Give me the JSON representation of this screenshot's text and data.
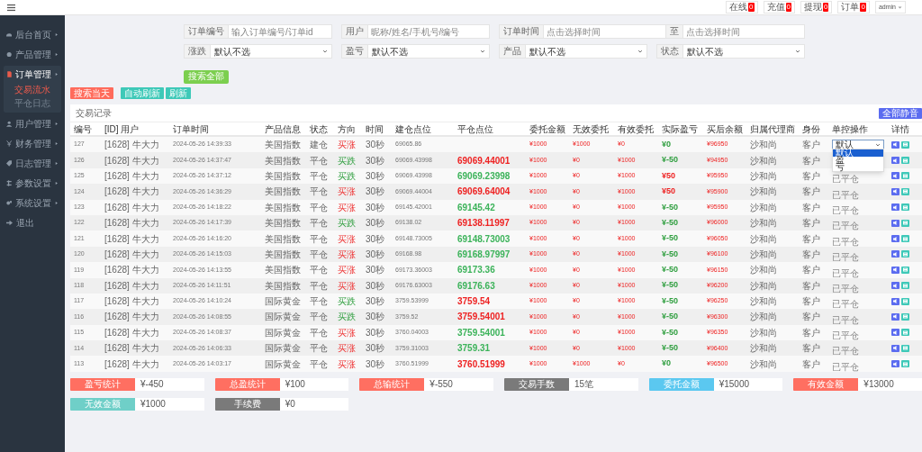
{
  "topbar": {
    "counters": [
      {
        "label": "在线",
        "count": "0"
      },
      {
        "label": "充值",
        "count": "0"
      },
      {
        "label": "提现",
        "count": "0"
      },
      {
        "label": "订单",
        "count": "0"
      }
    ],
    "user": "admin"
  },
  "sidebar": {
    "items": [
      {
        "label": "后台首页",
        "expanded": false
      },
      {
        "label": "产品管理",
        "expanded": false
      },
      {
        "label": "订单管理",
        "expanded": true,
        "children": [
          {
            "label": "交易流水",
            "selected": true
          },
          {
            "label": "平仓日志",
            "selected": false
          }
        ]
      },
      {
        "label": "用户管理",
        "expanded": false
      },
      {
        "label": "财务管理",
        "expanded": false
      },
      {
        "label": "日志管理",
        "expanded": false
      },
      {
        "label": "参数设置",
        "expanded": false
      },
      {
        "label": "系统设置",
        "expanded": false
      },
      {
        "label": "退出"
      }
    ]
  },
  "filter_rows": [
    [
      {
        "kind": "input",
        "label": "订单编号",
        "placeholder": "输入订单编号/订单id"
      },
      {
        "kind": "input",
        "label": "用户",
        "placeholder": "昵称/姓名/手机号/编号"
      },
      {
        "kind": "range",
        "label": "订单时间",
        "placeholder": "点击选择时间",
        "separator": "至",
        "placeholder_end": "点击选择时间"
      }
    ],
    [
      {
        "kind": "select",
        "label": "涨跌",
        "value": "默认不选"
      },
      {
        "kind": "select",
        "label": "盈亏",
        "value": "默认不选"
      },
      {
        "kind": "select",
        "label": "产品",
        "value": "默认不选"
      },
      {
        "kind": "select",
        "label": "状态",
        "value": "默认不选"
      }
    ]
  ],
  "search_all_button": "搜索全部",
  "action_buttons": [
    {
      "label": "搜索当天",
      "kind": "danger"
    },
    {
      "label": "自动刷新",
      "kind": "accent"
    },
    {
      "label": "刷新",
      "kind": "accent"
    }
  ],
  "table": {
    "title": "交易记录",
    "header_button": "全部静音",
    "columns": [
      "编号",
      "[ID] 用户",
      "订单时间",
      "产品信息",
      "状态",
      "方向",
      "时间",
      "建仓点位",
      "平仓点位",
      "委托金额",
      "无效委托",
      "有效委托",
      "实际盈亏",
      "买后余额",
      "归属代理商",
      "身份",
      "单控操作",
      "详情"
    ],
    "rows": [
      {
        "id": "127",
        "user": "[1628] 牛大力",
        "time": "2024-05-26 14:39:33",
        "product": "美国指数",
        "status": "建仓",
        "direction": "买涨",
        "rising": true,
        "duration": "30秒",
        "open_price": "69065.86",
        "entrust": "¥1000",
        "invalid": "¥1000",
        "valid": "¥0",
        "profit": {
          "text": "¥0",
          "color": "#2e9e3e"
        },
        "balance": "¥96950",
        "agent": "沙和尚",
        "role": "客户",
        "control": {
          "kind": "select",
          "value": "默认",
          "expanded": true,
          "options": [
            {
              "label": "默认",
              "selected": true
            },
            {
              "label": "盈",
              "selected": false
            },
            {
              "label": "亏",
              "selected": false
            }
          ]
        }
      },
      {
        "id": "126",
        "user": "[1628] 牛大力",
        "time": "2024-05-26 14:37:47",
        "product": "美国指数",
        "status": "平仓",
        "direction": "买跌",
        "rising": false,
        "duration": "30秒",
        "open_price": "69069.43998",
        "close": {
          "text": "69069.44001",
          "color": "#ee2222"
        },
        "entrust": "¥1000",
        "invalid": "¥0",
        "valid": "¥1000",
        "profit": {
          "text": "¥-50",
          "color": "#2e9e3e"
        },
        "balance": "¥94950",
        "agent": "沙和尚",
        "role": "客户"
      },
      {
        "id": "125",
        "user": "[1628] 牛大力",
        "time": "2024-05-26 14:37:12",
        "product": "美国指数",
        "status": "平仓",
        "direction": "买跌",
        "rising": false,
        "duration": "30秒",
        "open_price": "69069.43998",
        "close": {
          "text": "69069.23998",
          "color": "#3cb35a"
        },
        "entrust": "¥1000",
        "invalid": "¥0",
        "valid": "¥1000",
        "profit": {
          "text": "¥50",
          "color": "#ee2222"
        },
        "balance": "¥95950",
        "agent": "沙和尚",
        "role": "客户",
        "control": {
          "kind": "text",
          "text": "已平仓"
        }
      },
      {
        "id": "124",
        "user": "[1628] 牛大力",
        "time": "2024-05-26 14:36:29",
        "product": "美国指数",
        "status": "平仓",
        "direction": "买涨",
        "rising": true,
        "duration": "30秒",
        "open_price": "69069.44004",
        "close": {
          "text": "69069.64004",
          "color": "#ee2222"
        },
        "entrust": "¥1000",
        "invalid": "¥0",
        "valid": "¥1000",
        "profit": {
          "text": "¥50",
          "color": "#ee2222"
        },
        "balance": "¥95900",
        "agent": "沙和尚",
        "role": "客户",
        "control": {
          "kind": "text",
          "text": "已平仓"
        }
      },
      {
        "id": "123",
        "user": "[1628] 牛大力",
        "time": "2024-05-26 14:18:22",
        "product": "美国指数",
        "status": "平仓",
        "direction": "买涨",
        "rising": true,
        "duration": "30秒",
        "open_price": "69145.42001",
        "close": {
          "text": "69145.42",
          "color": "#3cb35a"
        },
        "entrust": "¥1000",
        "invalid": "¥0",
        "valid": "¥1000",
        "profit": {
          "text": "¥-50",
          "color": "#2e9e3e"
        },
        "balance": "¥95950",
        "agent": "沙和尚",
        "role": "客户",
        "control": {
          "kind": "text",
          "text": "已平仓"
        }
      },
      {
        "id": "122",
        "user": "[1628] 牛大力",
        "time": "2024-05-26 14:17:39",
        "product": "美国指数",
        "status": "平仓",
        "direction": "买跌",
        "rising": false,
        "duration": "30秒",
        "open_price": "69138.02",
        "close": {
          "text": "69138.11997",
          "color": "#ee2222"
        },
        "entrust": "¥1000",
        "invalid": "¥0",
        "valid": "¥1000",
        "profit": {
          "text": "¥-50",
          "color": "#2e9e3e"
        },
        "balance": "¥96000",
        "agent": "沙和尚",
        "role": "客户",
        "control": {
          "kind": "text",
          "text": "已平仓"
        }
      },
      {
        "id": "121",
        "user": "[1628] 牛大力",
        "time": "2024-05-26 14:16:20",
        "product": "美国指数",
        "status": "平仓",
        "direction": "买涨",
        "rising": true,
        "duration": "30秒",
        "open_price": "69148.73005",
        "close": {
          "text": "69148.73003",
          "color": "#3cb35a"
        },
        "entrust": "¥1000",
        "invalid": "¥0",
        "valid": "¥1000",
        "profit": {
          "text": "¥-50",
          "color": "#2e9e3e"
        },
        "balance": "¥96050",
        "agent": "沙和尚",
        "role": "客户",
        "control": {
          "kind": "text",
          "text": "已平仓"
        }
      },
      {
        "id": "120",
        "user": "[1628] 牛大力",
        "time": "2024-05-26 14:15:03",
        "product": "美国指数",
        "status": "平仓",
        "direction": "买涨",
        "rising": true,
        "duration": "30秒",
        "open_price": "69168.98",
        "close": {
          "text": "69168.97997",
          "color": "#3cb35a"
        },
        "entrust": "¥1000",
        "invalid": "¥0",
        "valid": "¥1000",
        "profit": {
          "text": "¥-50",
          "color": "#2e9e3e"
        },
        "balance": "¥96100",
        "agent": "沙和尚",
        "role": "客户",
        "control": {
          "kind": "text",
          "text": "已平仓"
        }
      },
      {
        "id": "119",
        "user": "[1628] 牛大力",
        "time": "2024-05-26 14:13:55",
        "product": "美国指数",
        "status": "平仓",
        "direction": "买涨",
        "rising": true,
        "duration": "30秒",
        "open_price": "69173.36003",
        "close": {
          "text": "69173.36",
          "color": "#3cb35a"
        },
        "entrust": "¥1000",
        "invalid": "¥0",
        "valid": "¥1000",
        "profit": {
          "text": "¥-50",
          "color": "#2e9e3e"
        },
        "balance": "¥96150",
        "agent": "沙和尚",
        "role": "客户",
        "control": {
          "kind": "text",
          "text": "已平仓"
        }
      },
      {
        "id": "118",
        "user": "[1628] 牛大力",
        "time": "2024-05-26 14:11:51",
        "product": "美国指数",
        "status": "平仓",
        "direction": "买涨",
        "rising": true,
        "duration": "30秒",
        "open_price": "69176.63003",
        "close": {
          "text": "69176.63",
          "color": "#3cb35a"
        },
        "entrust": "¥1000",
        "invalid": "¥0",
        "valid": "¥1000",
        "profit": {
          "text": "¥-50",
          "color": "#2e9e3e"
        },
        "balance": "¥96200",
        "agent": "沙和尚",
        "role": "客户",
        "control": {
          "kind": "text",
          "text": "已平仓"
        }
      },
      {
        "id": "117",
        "user": "[1628] 牛大力",
        "time": "2024-05-26 14:10:24",
        "product": "国际黄金",
        "status": "平仓",
        "direction": "买跌",
        "rising": false,
        "duration": "30秒",
        "open_price": "3759.53999",
        "close": {
          "text": "3759.54",
          "color": "#ee2222"
        },
        "entrust": "¥1000",
        "invalid": "¥0",
        "valid": "¥1000",
        "profit": {
          "text": "¥-50",
          "color": "#2e9e3e"
        },
        "balance": "¥96250",
        "agent": "沙和尚",
        "role": "客户",
        "control": {
          "kind": "text",
          "text": "已平仓"
        }
      },
      {
        "id": "116",
        "user": "[1628] 牛大力",
        "time": "2024-05-26 14:08:55",
        "product": "国际黄金",
        "status": "平仓",
        "direction": "买跌",
        "rising": false,
        "duration": "30秒",
        "open_price": "3759.52",
        "close": {
          "text": "3759.54001",
          "color": "#ee2222"
        },
        "entrust": "¥1000",
        "invalid": "¥0",
        "valid": "¥1000",
        "profit": {
          "text": "¥-50",
          "color": "#2e9e3e"
        },
        "balance": "¥96300",
        "agent": "沙和尚",
        "role": "客户",
        "control": {
          "kind": "text",
          "text": "已平仓"
        }
      },
      {
        "id": "115",
        "user": "[1628] 牛大力",
        "time": "2024-05-26 14:08:37",
        "product": "国际黄金",
        "status": "平仓",
        "direction": "买涨",
        "rising": true,
        "duration": "30秒",
        "open_price": "3760.04003",
        "close": {
          "text": "3759.54001",
          "color": "#3cb35a"
        },
        "entrust": "¥1000",
        "invalid": "¥0",
        "valid": "¥1000",
        "profit": {
          "text": "¥-50",
          "color": "#2e9e3e"
        },
        "balance": "¥96350",
        "agent": "沙和尚",
        "role": "客户",
        "control": {
          "kind": "text",
          "text": "已平仓"
        }
      },
      {
        "id": "114",
        "user": "[1628] 牛大力",
        "time": "2024-05-26 14:06:33",
        "product": "国际黄金",
        "status": "平仓",
        "direction": "买涨",
        "rising": true,
        "duration": "30秒",
        "open_price": "3759.31003",
        "close": {
          "text": "3759.31",
          "color": "#3cb35a"
        },
        "entrust": "¥1000",
        "invalid": "¥0",
        "valid": "¥1000",
        "profit": {
          "text": "¥-50",
          "color": "#2e9e3e"
        },
        "balance": "¥96400",
        "agent": "沙和尚",
        "role": "客户",
        "control": {
          "kind": "text",
          "text": "已平仓"
        }
      },
      {
        "id": "113",
        "user": "[1628] 牛大力",
        "time": "2024-05-26 14:03:17",
        "product": "国际黄金",
        "status": "平仓",
        "direction": "买涨",
        "rising": true,
        "duration": "30秒",
        "open_price": "3760.51999",
        "close": {
          "text": "3760.51999",
          "color": "#ee2222"
        },
        "entrust": "¥1000",
        "invalid": "¥1000",
        "valid": "¥0",
        "profit": {
          "text": "¥0",
          "color": "#2e9e3e"
        },
        "balance": "¥96500",
        "agent": "沙和尚",
        "role": "客户",
        "control": {
          "kind": "text",
          "text": "已平仓"
        }
      }
    ]
  },
  "stats": [
    {
      "label": "盈亏统计",
      "value": "¥-450",
      "color": "#ff6f61"
    },
    {
      "label": "总盈统计",
      "value": "¥100",
      "color": "#ff6f61"
    },
    {
      "label": "总输统计",
      "value": "¥-550",
      "color": "#ff6f61"
    },
    {
      "label": "交易手数",
      "value": "15笔",
      "color": "#7a7a7a"
    },
    {
      "label": "委托金额",
      "value": "¥15000",
      "color": "#5bc8f0"
    },
    {
      "label": "有效金额",
      "value": "¥13000",
      "color": "#ff6f61"
    },
    {
      "label": "无效金额",
      "value": "¥1000",
      "color": "#6fcfc8"
    },
    {
      "label": "手续费",
      "value": "¥0",
      "color": "#7a7a7a"
    }
  ]
}
